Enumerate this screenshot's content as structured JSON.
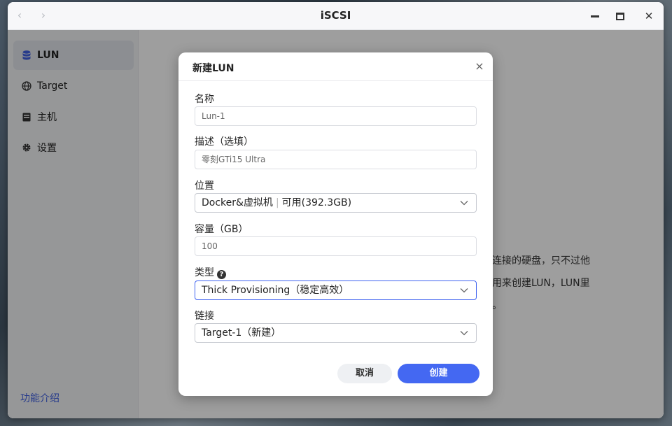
{
  "window": {
    "title": "iSCSI",
    "nav_back": "‹",
    "nav_forward": "›",
    "close_glyph": "✕"
  },
  "sidebar": {
    "items": [
      {
        "label": "LUN",
        "icon": "database-icon",
        "active": true
      },
      {
        "label": "Target",
        "icon": "globe-icon",
        "active": false
      },
      {
        "label": "主机",
        "icon": "server-icon",
        "active": false
      },
      {
        "label": "设置",
        "icon": "gear-icon",
        "active": false
      }
    ],
    "feature_link": "功能介绍"
  },
  "main": {
    "text_lines": [
      "连接的硬盘，只不过他",
      "用来创建LUN，LUN里",
      "。"
    ]
  },
  "dialog": {
    "title": "新建LUN",
    "close_glyph": "×",
    "name": {
      "label": "名称",
      "value": "Lun-1"
    },
    "description": {
      "label": "描述（选填）",
      "value": "零刻GTi15 Ultra"
    },
    "location": {
      "label": "位置",
      "value": "Docker&虚拟机",
      "separator": "|",
      "available": "可用(392.3GB)"
    },
    "capacity": {
      "label": "容量（GB）",
      "value": "100"
    },
    "type": {
      "label": "类型",
      "help_glyph": "?",
      "value": "Thick Provisioning（稳定高效）"
    },
    "link": {
      "label": "链接",
      "value": "Target-1（新建）"
    },
    "cancel_label": "取消",
    "create_label": "创建"
  },
  "colors": {
    "accent": "#4468f2",
    "link": "#3f5fe0",
    "focus_border": "#3f63f0"
  }
}
